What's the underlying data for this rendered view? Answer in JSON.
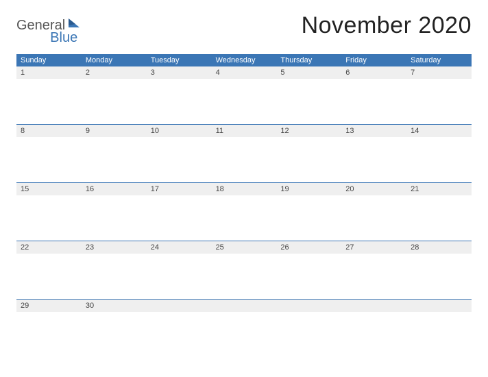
{
  "brand": {
    "word1": "General",
    "word2": "Blue"
  },
  "title": "November 2020",
  "days": [
    "Sunday",
    "Monday",
    "Tuesday",
    "Wednesday",
    "Thursday",
    "Friday",
    "Saturday"
  ],
  "weeks": [
    [
      "1",
      "2",
      "3",
      "4",
      "5",
      "6",
      "7"
    ],
    [
      "8",
      "9",
      "10",
      "11",
      "12",
      "13",
      "14"
    ],
    [
      "15",
      "16",
      "17",
      "18",
      "19",
      "20",
      "21"
    ],
    [
      "22",
      "23",
      "24",
      "25",
      "26",
      "27",
      "28"
    ],
    [
      "29",
      "30",
      "",
      "",
      "",
      "",
      ""
    ]
  ],
  "colors": {
    "accent": "#3b76b5"
  }
}
